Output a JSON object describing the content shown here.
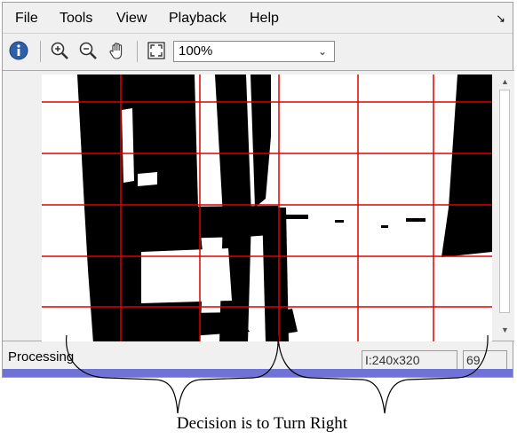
{
  "menubar": {
    "items": [
      "File",
      "Tools",
      "View",
      "Playback",
      "Help"
    ],
    "dock_icon": "undock-arrow-icon"
  },
  "toolbar": {
    "info_icon": "info-icon",
    "zoom_in_icon": "zoom-in-icon",
    "zoom_out_icon": "zoom-out-icon",
    "pan_icon": "hand-pan-icon",
    "fit_icon": "fit-to-window-icon",
    "zoom_value": "100%"
  },
  "status": {
    "text": "Processing",
    "resolution": "I:240x320",
    "frame": "69"
  },
  "annotation": {
    "caption": "Decision is to Turn Right"
  },
  "colors": {
    "grid_line": "#e00000",
    "accent_bar": "#6f73d6"
  }
}
